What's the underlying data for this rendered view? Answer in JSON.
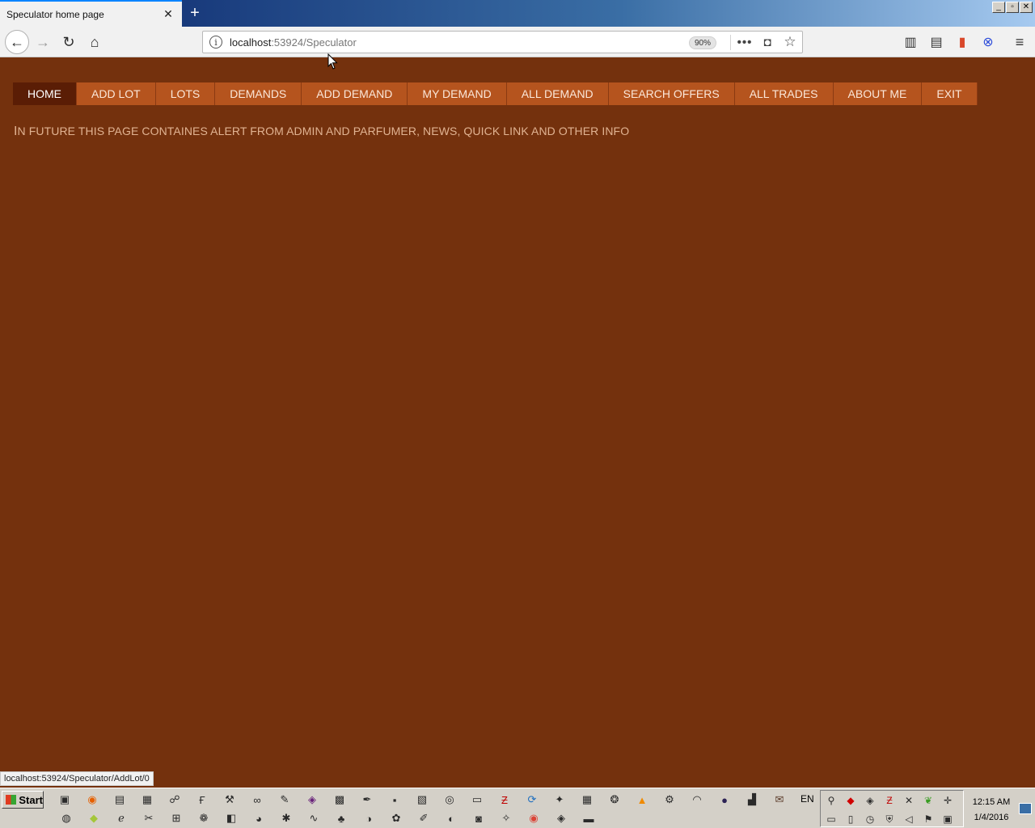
{
  "browser": {
    "tab_title": "Speculator home page",
    "tab_close_glyph": "✕",
    "newtab_glyph": "+",
    "url_host": "localhost",
    "url_rest": ":53924/Speculator",
    "zoom": "90%",
    "status_url": "localhost:53924/Speculator/AddLot/0",
    "icons": {
      "back": "←",
      "forward": "→",
      "reload": "↻",
      "home": "⌂",
      "info": "i",
      "more": "•••",
      "pocket": "◘",
      "star": "☆",
      "library": "▥",
      "sidebar": "▤",
      "ext1": "▮",
      "ext2": "⊗",
      "menu": "≡"
    },
    "window_controls": [
      "_",
      "▫",
      "✕"
    ]
  },
  "page": {
    "menu": [
      {
        "label": "HOME",
        "active": true
      },
      {
        "label": "ADD LOT"
      },
      {
        "label": "LOTS"
      },
      {
        "label": "DEMANDS"
      },
      {
        "label": "ADD DEMAND"
      },
      {
        "label": "MY DEMAND"
      },
      {
        "label": "ALL DEMAND"
      },
      {
        "label": "SEARCH OFFERS"
      },
      {
        "label": "ALL TRADES"
      },
      {
        "label": "ABOUT ME"
      },
      {
        "label": "EXIT"
      }
    ],
    "notice_first": "I",
    "notice_rest": "N FUTURE THIS PAGE CONTAINES ALERT FROM ADMIN AND PARFUMER, NEWS, QUICK LINK AND OTHER INFO"
  },
  "taskbar": {
    "start_label": "Start",
    "lang": "EN",
    "time": "12:15 AM",
    "date": "1/4/2016",
    "row1_icons": [
      "cmd-icon",
      "firefox-icon",
      "notepad-icon",
      "explorer-icon",
      "network-icon",
      "fb-icon",
      "tools-icon",
      "infinity-icon",
      "paint-icon",
      "visualstudio-icon",
      "terminal-icon",
      "pen-icon",
      "save-icon",
      "note-icon",
      "disc-icon",
      "window-icon",
      "filezilla-icon",
      "sync-icon",
      "satellite-icon",
      "calendar-icon",
      "gear-globe-icon",
      "vlc-icon",
      "settings-icon",
      "headphones-icon",
      "eclipse-icon",
      "chart-icon",
      "mail-icon"
    ],
    "row2_icons": [
      "blender-icon",
      "android-icon",
      "ie-icon",
      "tool-icon",
      "network2-icon",
      "chrome-gear-icon",
      "cube-icon",
      "globe-icon",
      "bug-icon",
      "python-icon",
      "tree-icon",
      "earth-icon",
      "green-icon",
      "brush-icon",
      "globe2-icon",
      "lock-icon",
      "dna-icon",
      "chrome-icon",
      "shield-icon",
      "folder-icon"
    ],
    "tray_row1": [
      "tray-network-icon",
      "tray-diamond-icon",
      "tray-shield-icon",
      "tray-filezilla-icon",
      "tray-sword-icon",
      "tray-leaf-icon",
      "tray-compass-icon"
    ],
    "tray_row2": [
      "tray-monitor-icon",
      "tray-drive-icon",
      "tray-clock-icon",
      "tray-security-icon",
      "tray-volume-icon",
      "tray-flag-icon",
      "tray-display-icon"
    ],
    "glyphs": {
      "cmd-icon": "▣",
      "firefox-icon": "◉",
      "notepad-icon": "▤",
      "explorer-icon": "▦",
      "network-icon": "☍",
      "fb-icon": "Ғ",
      "tools-icon": "⚒",
      "infinity-icon": "∞",
      "paint-icon": "✎",
      "visualstudio-icon": "◈",
      "terminal-icon": "▩",
      "pen-icon": "✒",
      "save-icon": "▪",
      "note-icon": "▧",
      "disc-icon": "◎",
      "window-icon": "▭",
      "filezilla-icon": "Ƶ",
      "sync-icon": "⟳",
      "satellite-icon": "✦",
      "calendar-icon": "▦",
      "gear-globe-icon": "❂",
      "vlc-icon": "▲",
      "settings-icon": "⚙",
      "headphones-icon": "◠",
      "eclipse-icon": "●",
      "chart-icon": "▟",
      "mail-icon": "✉",
      "blender-icon": "◍",
      "android-icon": "◆",
      "ie-icon": "ℯ",
      "tool-icon": "✂",
      "network2-icon": "⊞",
      "chrome-gear-icon": "❁",
      "cube-icon": "◧",
      "globe-icon": "◕",
      "bug-icon": "✱",
      "python-icon": "∿",
      "tree-icon": "♣",
      "earth-icon": "◑",
      "green-icon": "✿",
      "brush-icon": "✐",
      "globe2-icon": "◐",
      "lock-icon": "◙",
      "dna-icon": "✧",
      "chrome-icon": "◉",
      "shield-icon": "◈",
      "folder-icon": "▬",
      "tray-network-icon": "⚲",
      "tray-diamond-icon": "◆",
      "tray-shield-icon": "◈",
      "tray-filezilla-icon": "Ƶ",
      "tray-sword-icon": "✕",
      "tray-leaf-icon": "❦",
      "tray-compass-icon": "✛",
      "tray-monitor-icon": "▭",
      "tray-drive-icon": "▯",
      "tray-clock-icon": "◷",
      "tray-security-icon": "⛨",
      "tray-volume-icon": "◁",
      "tray-flag-icon": "⚑",
      "tray-display-icon": "▣"
    },
    "colors": {
      "firefox-icon": "#e66000",
      "filezilla-icon": "#bf0000",
      "vlc-icon": "#f08a00",
      "visualstudio-icon": "#68217a",
      "chrome-icon": "#db4437",
      "android-icon": "#a4c639",
      "tray-diamond-icon": "#d00000",
      "tray-filezilla-icon": "#bf0000",
      "tray-leaf-icon": "#3a9d23",
      "eclipse-icon": "#2c2255",
      "mail-icon": "#5b3b2a",
      "sync-icon": "#1f6fbf"
    }
  },
  "colors": {
    "page_bg": "#74310d",
    "menu_bg": "#b5541e",
    "menu_active_bg": "#5a1d05",
    "notice_text": "#e1b392"
  }
}
